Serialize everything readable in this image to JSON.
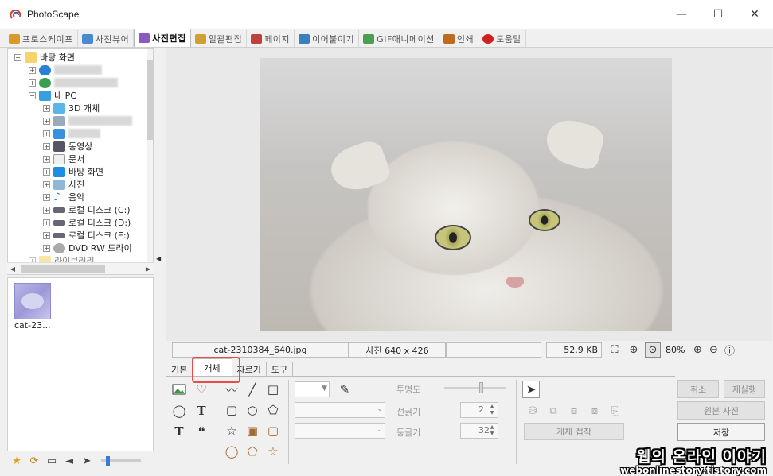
{
  "window": {
    "title": "PhotoScape",
    "minimize_glyph": "—",
    "maximize_glyph": "☐",
    "close_glyph": "✕"
  },
  "main_tabs": [
    {
      "label": "프로스케이프",
      "icon": "photoscape-home-icon",
      "color": "#d89a2a"
    },
    {
      "label": "사진뷰어",
      "icon": "photo-viewer-icon",
      "color": "#4a8ad0"
    },
    {
      "label": "사진편집",
      "icon": "photo-editor-icon",
      "color": "#8a5ac0",
      "active": true
    },
    {
      "label": "일괄편집",
      "icon": "batch-editor-icon",
      "color": "#d0a030"
    },
    {
      "label": "페이지",
      "icon": "page-icon",
      "color": "#c04040"
    },
    {
      "label": "이어붙이기",
      "icon": "combine-icon",
      "color": "#3a80c0"
    },
    {
      "label": "GIF애니메이션",
      "icon": "gif-animation-icon",
      "color": "#4aa050"
    },
    {
      "label": "인쇄",
      "icon": "print-icon",
      "color": "#c06a20"
    },
    {
      "label": "도움말",
      "icon": "help-icon",
      "color": "#d02020"
    }
  ],
  "tree": {
    "root_label": "바탕 화면",
    "my_pc_label": "내 PC",
    "children": [
      "3D 개체",
      "동영상",
      "문서",
      "바탕 화면",
      "사진",
      "음악",
      "로컬 디스크 (C:)",
      "로컬 디스크 (D:)",
      "로컬 디스크 (E:)",
      "DVD RW 드라이"
    ],
    "truncated_item": "라이브러리"
  },
  "thumbnails": [
    {
      "label": "cat-23..."
    }
  ],
  "status": {
    "filename": "cat-2310384_640.jpg",
    "dimensions": "사진 640 x 426",
    "filesize": "52.9 KB",
    "zoom": "80%"
  },
  "edit_tabs": [
    "기본",
    "개체",
    "자르기",
    "도구"
  ],
  "active_edit_tab": "개체",
  "object_panel": {
    "opacity_label": "투명도",
    "line_width_label": "선굵기",
    "line_width_value": "2",
    "roundness_label": "둥글기",
    "roundness_value": "32",
    "attach_object_label": "개체 접착"
  },
  "actions": {
    "undo": "취소",
    "redo": "재실행",
    "original": "원본 사진",
    "save": "저장"
  },
  "watermark": {
    "line1": "웹의 온라인 이야기",
    "line2": "webonlinestory.tistory.com"
  }
}
